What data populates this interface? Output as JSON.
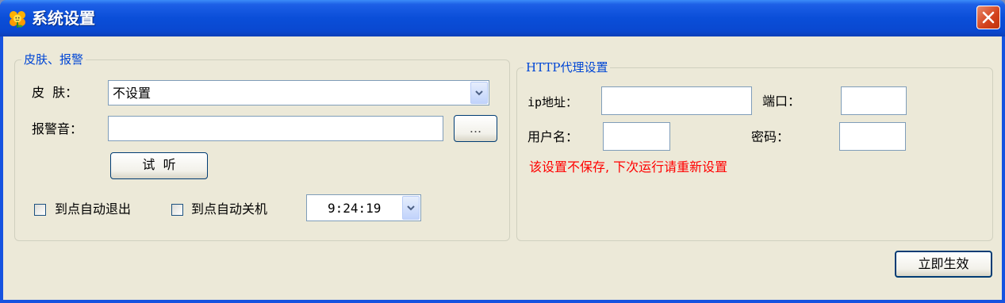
{
  "window": {
    "title": "系统设置",
    "icon": "flower-app-icon",
    "close_icon": "close-icon"
  },
  "skin_alarm": {
    "title": "皮肤、报警",
    "skin_label": "皮  肤：",
    "skin_value": "不设置",
    "alarm_label": "报警音：",
    "alarm_value": "",
    "browse_label": "...",
    "listen_label": "试  听",
    "auto_exit_label": "到点自动退出",
    "auto_exit_checked": false,
    "auto_shutdown_label": "到点自动关机",
    "auto_shutdown_checked": false,
    "time_value": "9:24:19"
  },
  "http_proxy": {
    "title": "HTTP代理设置",
    "ip_label": "ip地址：",
    "ip_value": "",
    "port_label": "端口：",
    "port_value": "",
    "username_label": "用户名：",
    "username_value": "",
    "password_label": "密码：",
    "password_value": "",
    "warning": "该设置不保存, 下次运行请重新设置"
  },
  "footer": {
    "apply_label": "立即生效"
  },
  "colors": {
    "title_bar": "#0a4ed8",
    "group_title": "#0046d5",
    "warning": "#ff0000",
    "window_bg": "#ece9d8"
  }
}
